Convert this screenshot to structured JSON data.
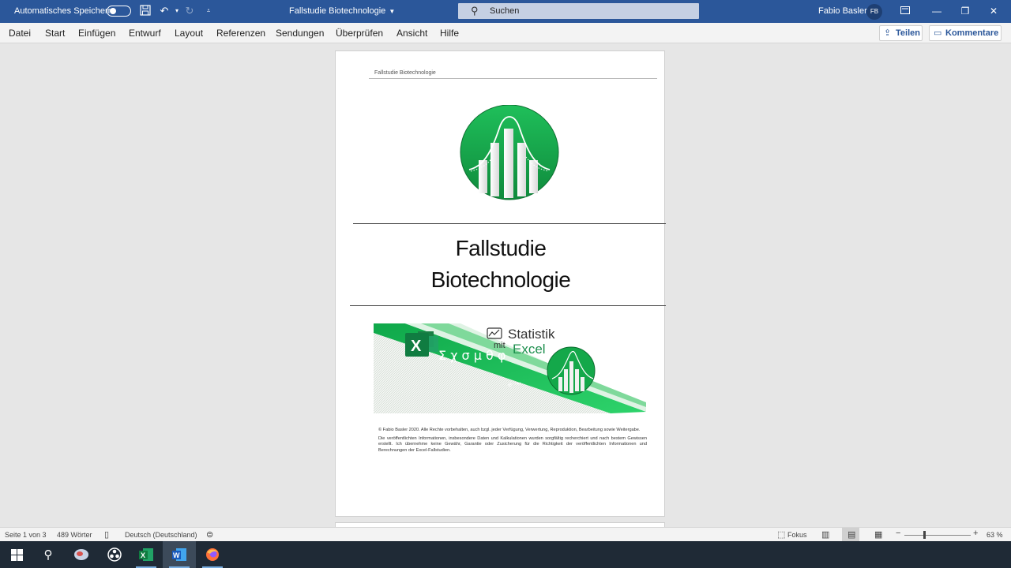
{
  "titlebar": {
    "autosave_label": "Automatisches Speichern",
    "doc_title": "Fallstudie Biotechnologie",
    "search_placeholder": "Suchen",
    "user_name": "Fabio Basler",
    "avatar_initials": "FB"
  },
  "ribbon": {
    "tabs": [
      "Datei",
      "Start",
      "Einfügen",
      "Entwurf",
      "Layout",
      "Referenzen",
      "Sendungen",
      "Überprüfen",
      "Ansicht",
      "Hilfe"
    ],
    "share_label": "Teilen",
    "comments_label": "Kommentare"
  },
  "document": {
    "header_text": "Fallstudie Biotechnologie",
    "title_line1": "Fallstudie",
    "title_line2": "Biotechnologie",
    "banner": {
      "word_statistik": "Statistik",
      "word_mit": "mit",
      "word_excel": "Excel",
      "symbols": "Σ χ σ μ θ φ"
    },
    "legal_p1": "© Fabio Basler 2020. Alle Rechte vorbehalten, auch bzgl. jeder Verfügung, Verwertung, Reproduktion, Bearbeitung sowie Weitergabe.",
    "legal_p2": "Die veröffentlichten Informationen, insbesondere Daten und Kalkulationen wurden sorgfältig recherchiert und nach bestem Gewissen erstellt. Ich übernehme keine Gewähr, Garantie oder Zusicherung für die Richtigkeit der veröffentlichten Informationen und Berechnungen der Excel-Fallstudien."
  },
  "statusbar": {
    "page_info": "Seite 1 von 3",
    "word_count": "489 Wörter",
    "language": "Deutsch (Deutschland)",
    "focus_label": "Fokus",
    "zoom": "63 %"
  },
  "colors": {
    "word_blue": "#2b579a",
    "excel_green": "#1d8f4e",
    "logo_green": "#14a84a"
  }
}
